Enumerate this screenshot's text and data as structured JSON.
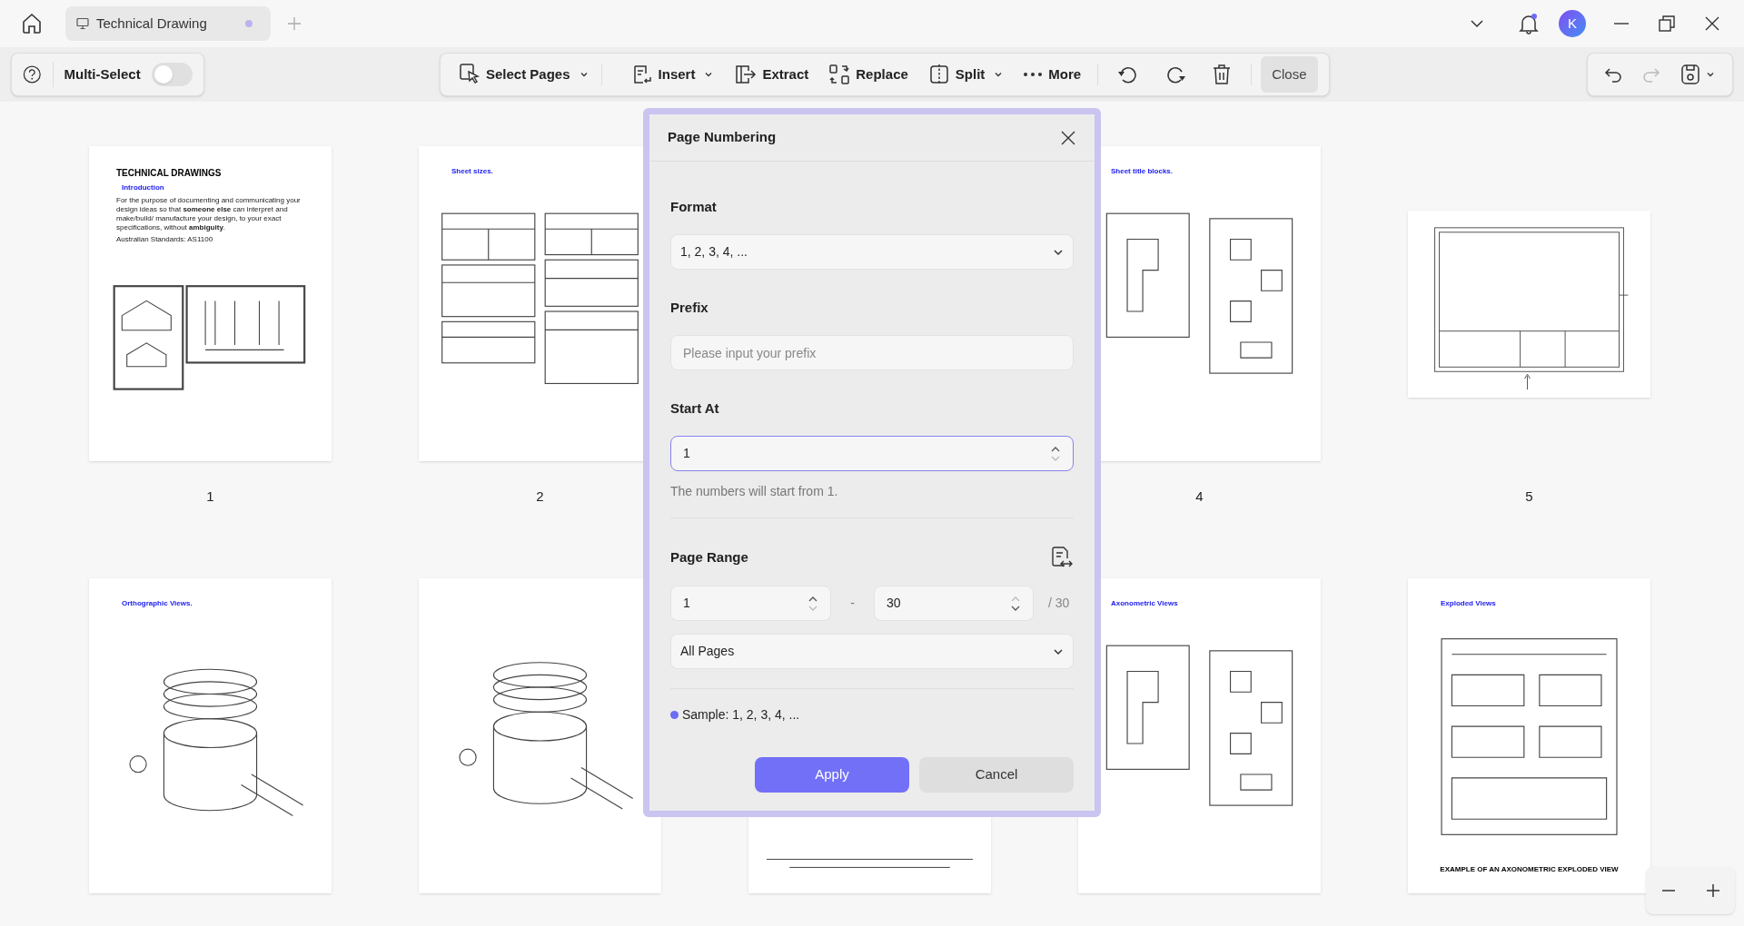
{
  "tab": {
    "title": "Technical Drawing",
    "unsaved": true
  },
  "avatar": "K",
  "multi_select": {
    "label": "Multi-Select",
    "on": false
  },
  "toolbar": [
    {
      "label": "Select Pages",
      "dropdown": true
    },
    {
      "label": "Insert",
      "dropdown": true
    },
    {
      "label": "Extract",
      "dropdown": false
    },
    {
      "label": "Replace",
      "dropdown": false
    },
    {
      "label": "Split",
      "dropdown": true
    },
    {
      "label": "More",
      "dropdown": false
    }
  ],
  "close_button": "Close",
  "pages": [
    {
      "label": "1",
      "kind": "portrait",
      "texts": [
        {
          "kind": "heading",
          "text": "TECHNICAL DRAWINGS"
        },
        {
          "kind": "subheading",
          "text": "Introduction"
        },
        {
          "kind": "body",
          "text": "For the purpose of documenting and communicating your design ideas so that **someone else** can interpret and make/build/ manufacture your design, to your exact specifications, without **ambiguity**."
        },
        {
          "kind": "body",
          "text": "Australian Standards:  AS1100"
        }
      ]
    },
    {
      "label": "2",
      "kind": "portrait",
      "texts": [
        {
          "kind": "subheading",
          "text": "Sheet sizes."
        }
      ]
    },
    {
      "label": "4",
      "kind": "portrait",
      "texts": [
        {
          "kind": "subheading",
          "text": "Sheet title blocks."
        }
      ]
    },
    {
      "label": "5",
      "kind": "landscape"
    },
    {
      "kind": "portrait",
      "texts": [
        {
          "kind": "subheading",
          "text": "Orthographic Views."
        }
      ]
    },
    {
      "kind": "portrait"
    },
    {
      "kind": "portrait"
    },
    {
      "kind": "portrait",
      "texts": [
        {
          "kind": "subheading",
          "text": "Axonometric Views"
        }
      ]
    },
    {
      "kind": "portrait",
      "texts": [
        {
          "kind": "subheading",
          "text": "Exploded Views"
        },
        {
          "kind": "caption",
          "text": "EXAMPLE OF AN AXONOMETRIC EXPLODED VIEW"
        }
      ]
    }
  ],
  "dialog": {
    "title": "Page Numbering",
    "format": {
      "label": "Format",
      "value": "1, 2, 3, 4, ..."
    },
    "prefix": {
      "label": "Prefix",
      "placeholder": "Please input your prefix"
    },
    "start_at": {
      "label": "Start At",
      "value": "1",
      "hint": "The numbers will start from 1."
    },
    "page_range": {
      "label": "Page Range",
      "from": "1",
      "separator": "-",
      "to": "30",
      "total": "/ 30",
      "scope": "All Pages"
    },
    "sample": "Sample: 1, 2, 3, 4, ...",
    "apply": "Apply",
    "cancel": "Cancel"
  }
}
